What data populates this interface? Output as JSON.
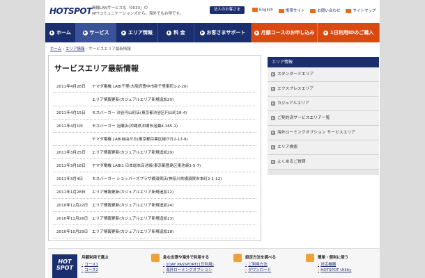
{
  "header": {
    "logo_text": "HOTSPOT",
    "tagline_1": "無線LANサービスも「0033」の",
    "tagline_2": "NTTコミュニケーションズから。海外でもお得です。",
    "customer_button": "法人のお客さま",
    "links": [
      "English",
      "携帯サイト",
      "お問い合わせ",
      "サイトマップ"
    ]
  },
  "nav": [
    {
      "label": "ホーム",
      "active": false,
      "orange": false
    },
    {
      "label": "サービス",
      "active": true,
      "orange": false
    },
    {
      "label": "エリア情報",
      "active": false,
      "orange": false
    },
    {
      "label": "料 金",
      "active": false,
      "orange": false
    },
    {
      "label": "お客さまサポート",
      "active": false,
      "orange": false
    },
    {
      "label": "月額コースのお申し込み",
      "active": false,
      "orange": true
    },
    {
      "label": "1日利用IDのご購入",
      "active": false,
      "orange": true
    }
  ],
  "breadcrumb": {
    "home": "ホーム",
    "sep1": " › ",
    "area": "エリア情報",
    "sep2": " › ",
    "current": "サービスエリア最新情報"
  },
  "main": {
    "title": "サービスエリア最新情報",
    "rows": [
      {
        "date": "2011年4月28日",
        "text": "ヤマダ電機 LABI千里(大阪府豊中市新千里東町1-2-20)"
      },
      {
        "date": "",
        "text": "エリア情報更新(カジュアルエリア新規追加20)"
      },
      {
        "date": "2011年4月15日",
        "text": "モスバーガー 渋谷円山町店(東京都渋谷区円山町28-4)"
      },
      {
        "date": "2011年4月1日",
        "text": "モスバーガー 泡瀬店(沖縄県沖縄市泡瀬4-165-1)"
      },
      {
        "date": "",
        "text": "ヤマダ電機 LABI自由が丘(東京都目黒区緑が丘2-17-9)"
      },
      {
        "date": "2011年3月25日",
        "text": "エリア情報更新(カジュアルエリア新規追加29)"
      },
      {
        "date": "2011年3月18日",
        "text": "ヤマダ電機 LABI1 日本総本店池袋(東京都豊島区東池袋1-5-7)"
      },
      {
        "date": "2011年3月4日",
        "text": "モスバーガー ショッパーズプラザ横須賀店(神奈川県横須賀市本町2-1-12)"
      },
      {
        "date": "2011年1月28日",
        "text": "エリア情報更新(カジュアルエリア新規追加12)"
      },
      {
        "date": "2010年12月22日",
        "text": "エリア情報更新(カジュアルエリア新規追加24)"
      },
      {
        "date": "2010年11月26日",
        "text": "エリア情報更新(カジュアルエリア新規追加13)"
      },
      {
        "date": "2010年10月29日",
        "text": "エリア情報更新(カジュアルエリア新規追加18)"
      }
    ]
  },
  "sidebar": {
    "heading": "エリア情報",
    "items": [
      "スタンダードエリア",
      "エクスプレスエリア",
      "カジュアルエリア",
      "ご契約済サービスエリア一覧",
      "海外ローミングオプション サービスエリア",
      "エリア検索",
      "よくあるご質問"
    ]
  },
  "footer": {
    "logo_line1": "HOT",
    "logo_line2": "SPOT",
    "col1": {
      "heading": "月額利用で選ぶ",
      "links": [
        "コース1",
        "コース2"
      ]
    },
    "col2": {
      "heading": "急な出張や海外で利用する",
      "links": [
        "1DAY PASSPORT(1日利用)",
        "海外ローミングオプション"
      ]
    },
    "col3": {
      "heading": "設定方法を調べる",
      "links": [
        "ご利用方法",
        "ダウンロード"
      ]
    },
    "col4": {
      "heading": "簡単・便利に使う",
      "links": [
        "対応機器",
        "HOTSPOT Utility"
      ]
    }
  }
}
